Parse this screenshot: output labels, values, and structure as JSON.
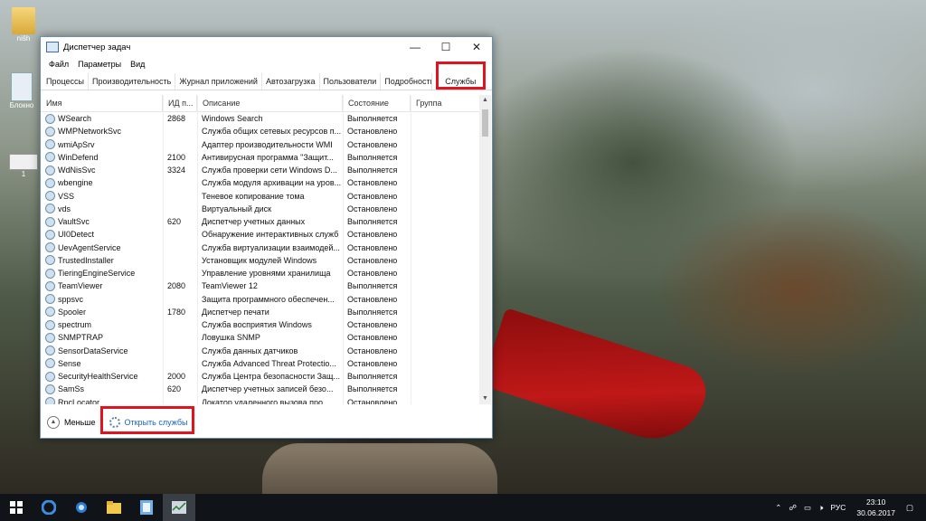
{
  "desktop": {
    "icons": [
      {
        "label": "nišh"
      },
      {
        "label": "Блокно"
      },
      {
        "label": "1"
      }
    ]
  },
  "window": {
    "title": "Диспетчер задач",
    "controls": {
      "minimize": "—",
      "maximize": "☐",
      "close": "✕"
    },
    "menu": [
      "Файл",
      "Параметры",
      "Вид"
    ],
    "tabs": [
      {
        "label": "Процессы"
      },
      {
        "label": "Производительность"
      },
      {
        "label": "Журнал приложений"
      },
      {
        "label": "Автозагрузка"
      },
      {
        "label": "Пользователи"
      },
      {
        "label": "Подробности"
      },
      {
        "label": "Службы"
      }
    ],
    "active_tab": "Службы",
    "columns": [
      "Имя",
      "ИД п...",
      "Описание",
      "Состояние",
      "Группа"
    ],
    "rows": [
      [
        "WSearch",
        "2868",
        "Windows Search",
        "Выполняется",
        ""
      ],
      [
        "WMPNetworkSvc",
        "",
        "Служба общих сетевых ресурсов п...",
        "Остановлено",
        ""
      ],
      [
        "wmiApSrv",
        "",
        "Адаптер производительности WMI",
        "Остановлено",
        ""
      ],
      [
        "WinDefend",
        "2100",
        "Антивирусная программа \"Защит...",
        "Выполняется",
        ""
      ],
      [
        "WdNisSvc",
        "3324",
        "Служба проверки сети Windows D...",
        "Выполняется",
        ""
      ],
      [
        "wbengine",
        "",
        "Служба модуля архивации на уров...",
        "Остановлено",
        ""
      ],
      [
        "VSS",
        "",
        "Теневое копирование тома",
        "Остановлено",
        ""
      ],
      [
        "vds",
        "",
        "Виртуальный диск",
        "Остановлено",
        ""
      ],
      [
        "VaultSvc",
        "620",
        "Диспетчер учетных данных",
        "Выполняется",
        ""
      ],
      [
        "UI0Detect",
        "",
        "Обнаружение интерактивных служб",
        "Остановлено",
        ""
      ],
      [
        "UevAgentService",
        "",
        "Служба виртуализации взаимодей...",
        "Остановлено",
        ""
      ],
      [
        "TrustedInstaller",
        "",
        "Установщик модулей Windows",
        "Остановлено",
        ""
      ],
      [
        "TieringEngineService",
        "",
        "Управление уровнями хранилища",
        "Остановлено",
        ""
      ],
      [
        "TeamViewer",
        "2080",
        "TeamViewer 12",
        "Выполняется",
        ""
      ],
      [
        "sppsvc",
        "",
        "Защита программного обеспечен...",
        "Остановлено",
        ""
      ],
      [
        "Spooler",
        "1780",
        "Диспетчер печати",
        "Выполняется",
        ""
      ],
      [
        "spectrum",
        "",
        "Служба восприятия Windows",
        "Остановлено",
        ""
      ],
      [
        "SNMPTRAP",
        "",
        "Ловушка SNMP",
        "Остановлено",
        ""
      ],
      [
        "SensorDataService",
        "",
        "Служба данных датчиков",
        "Остановлено",
        ""
      ],
      [
        "Sense",
        "",
        "Служба Advanced Threat Protectio...",
        "Остановлено",
        ""
      ],
      [
        "SecurityHealthService",
        "2000",
        "Служба Центра безопасности Защ...",
        "Выполняется",
        ""
      ],
      [
        "SamSs",
        "620",
        "Диспетчер учетных записей безо...",
        "Выполняется",
        ""
      ],
      [
        "RpcLocator",
        "",
        "Локатор удаленного вызова про...",
        "Остановлено",
        ""
      ]
    ],
    "footer": {
      "less_label": "Меньше",
      "open_services_label": "Открыть службы"
    }
  },
  "taskbar": {
    "apps": [
      "start-icon",
      "edge-icon",
      "app-icon",
      "explorer-icon",
      "notepad-icon",
      "task-manager-icon"
    ],
    "tray": {
      "language": "РУС",
      "time": "23:10",
      "date": "30.06.2017"
    }
  },
  "colors": {
    "highlight_box": "#e0141e",
    "link": "#1563c6"
  }
}
